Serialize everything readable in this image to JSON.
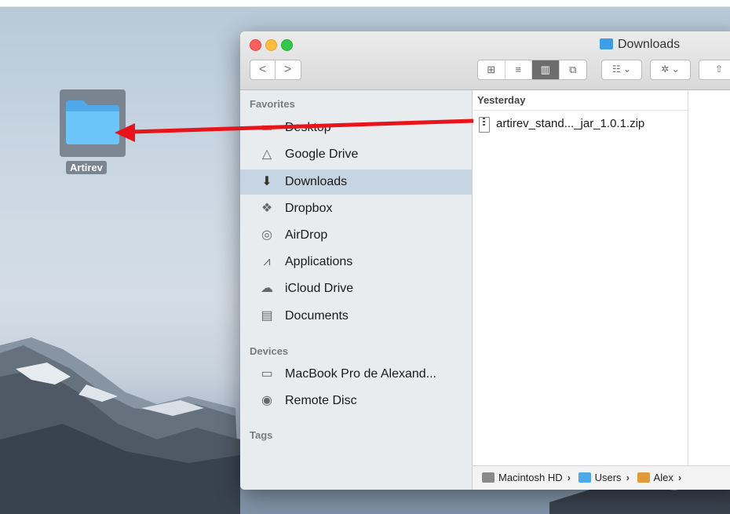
{
  "desktop": {
    "folder_label": "Artirev"
  },
  "window": {
    "title": "Downloads",
    "nav": {
      "back": "<",
      "forward": ">"
    },
    "view_buttons": [
      "⊞",
      "≡",
      "▥",
      "⧉"
    ],
    "arrange_label": "☷ ⌄",
    "action_label": "✲ ⌄",
    "share_label": "⇧"
  },
  "sidebar": {
    "favorites_label": "Favorites",
    "favorites": [
      {
        "label": "Desktop",
        "icon": "desktop-icon",
        "glyph": "▭"
      },
      {
        "label": "Google Drive",
        "icon": "google-drive-icon",
        "glyph": "△"
      },
      {
        "label": "Downloads",
        "icon": "downloads-icon",
        "glyph": "⬇",
        "selected": true
      },
      {
        "label": "Dropbox",
        "icon": "dropbox-icon",
        "glyph": "❖"
      },
      {
        "label": "AirDrop",
        "icon": "airdrop-icon",
        "glyph": "◎"
      },
      {
        "label": "Applications",
        "icon": "applications-icon",
        "glyph": "⩘"
      },
      {
        "label": "iCloud Drive",
        "icon": "icloud-icon",
        "glyph": "☁"
      },
      {
        "label": "Documents",
        "icon": "documents-icon",
        "glyph": "▤"
      }
    ],
    "devices_label": "Devices",
    "devices": [
      {
        "label": "MacBook Pro de Alexand...",
        "icon": "laptop-icon",
        "glyph": "▭"
      },
      {
        "label": "Remote Disc",
        "icon": "disc-icon",
        "glyph": "◉"
      }
    ],
    "tags_label": "Tags"
  },
  "column": {
    "header": "Yesterday",
    "file_name": "artirev_stand..._jar_1.0.1.zip"
  },
  "pathbar": {
    "crumbs": [
      "Macintosh HD",
      "Users",
      "Alex"
    ]
  },
  "colors": {
    "folder_blue": "#5bb8f5",
    "selection": "#c7d4e2",
    "arrow_red": "#e8141b"
  }
}
